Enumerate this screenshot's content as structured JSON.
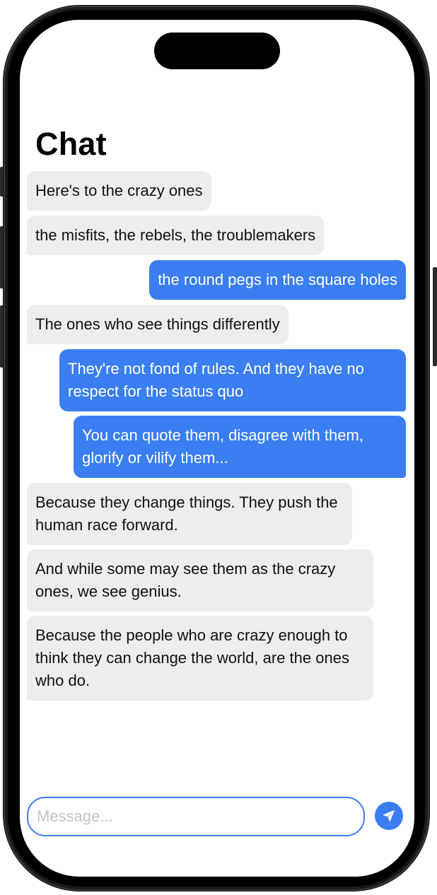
{
  "screen": {
    "title": "Chat"
  },
  "messages": [
    {
      "text": "Here's to the crazy ones",
      "direction": "incoming"
    },
    {
      "text": "the misfits, the rebels, the troublemakers",
      "direction": "incoming"
    },
    {
      "text": "the round pegs in the square holes",
      "direction": "outgoing"
    },
    {
      "text": "The ones who see things differently",
      "direction": "incoming"
    },
    {
      "text": "They're not fond of rules. And they have no respect for the status quo",
      "direction": "outgoing"
    },
    {
      "text": "You can quote them, disagree with them, glorify or vilify them...",
      "direction": "outgoing"
    },
    {
      "text": "Because they change things. They push the human race forward.",
      "direction": "incoming"
    },
    {
      "text": "And while some may see them as the crazy ones, we see genius.",
      "direction": "incoming"
    },
    {
      "text": "Because the people who are crazy enough to think they can change the world, are the ones who do.",
      "direction": "incoming"
    }
  ],
  "composer": {
    "placeholder": "Message...",
    "value": ""
  },
  "send_button": {
    "icon": "paper-plane-icon"
  },
  "colors": {
    "accent": "#3a7ef1",
    "incoming_bubble": "#efedeb",
    "outgoing_text": "#ffffff",
    "incoming_text": "#111111"
  }
}
